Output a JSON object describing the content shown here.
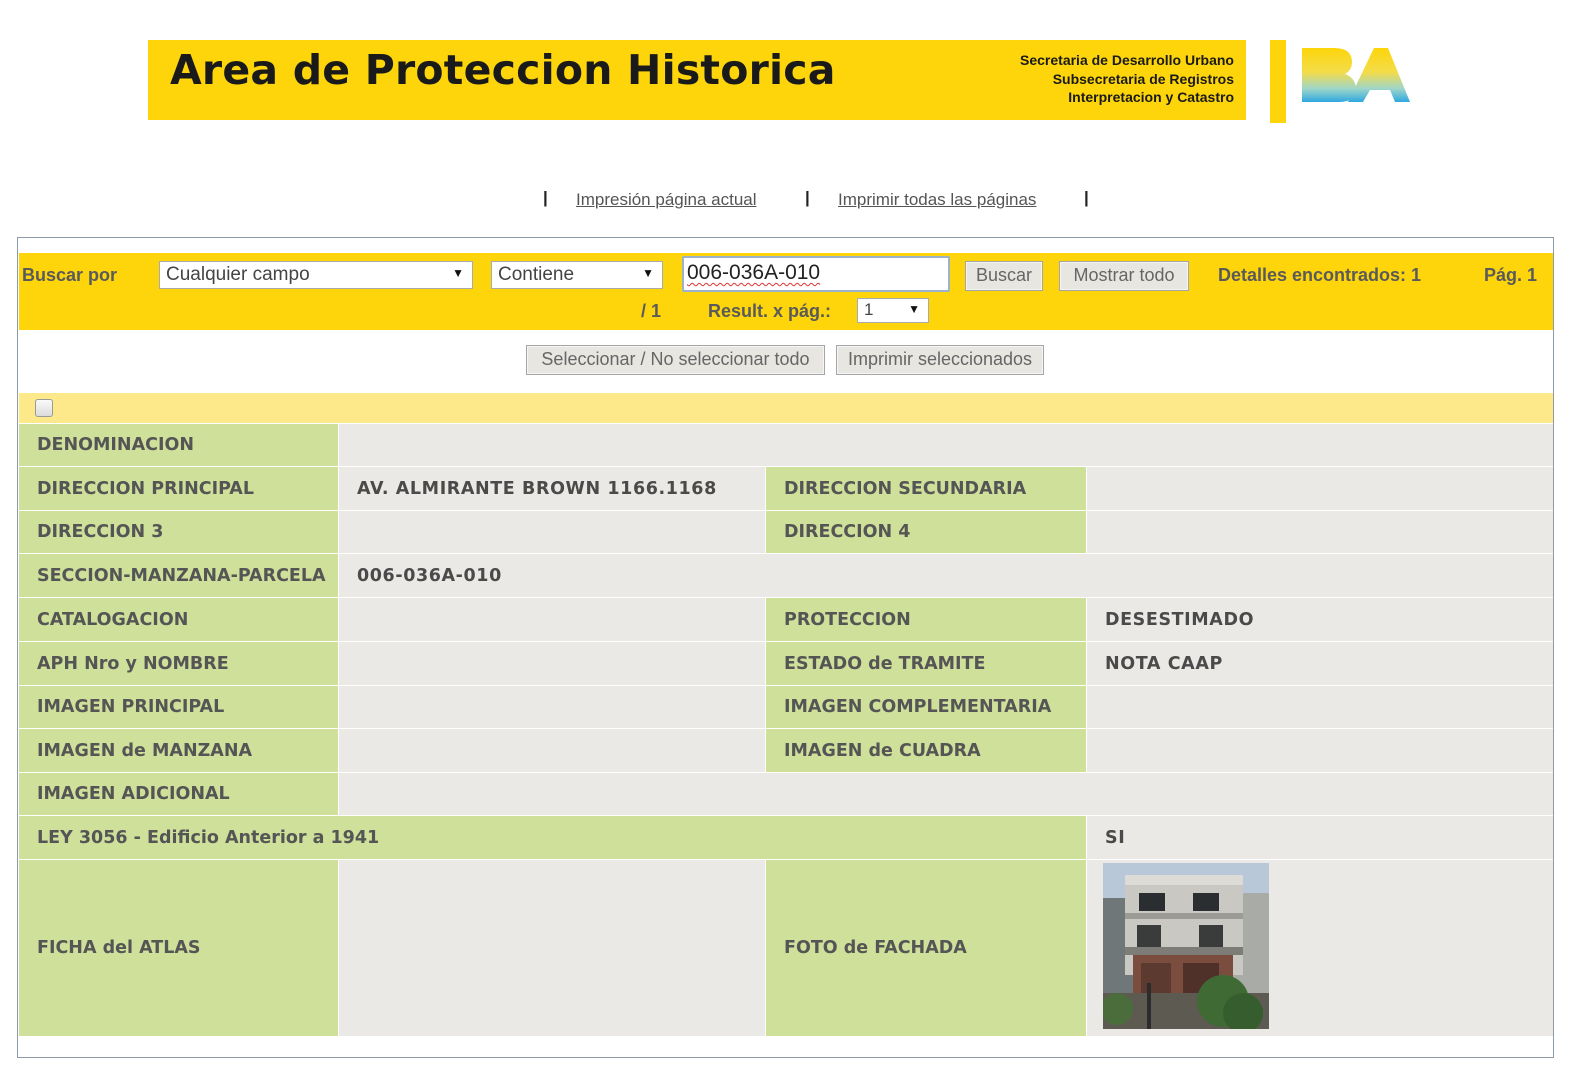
{
  "header": {
    "title": "Area de Proteccion Historica",
    "subtitle_lines": [
      "Secretaria de Desarrollo Urbano",
      "Subsecretaria de Registros",
      "Interpretacion y Catastro"
    ],
    "logo": "BA",
    "brand_color": "#fdd50a"
  },
  "print_links": {
    "separator": "|",
    "current_page": "Impresión página actual",
    "all_pages": "Imprimir todas las páginas"
  },
  "search": {
    "label": "Buscar por",
    "field_select": "Cualquier campo",
    "operator_select": "Contiene",
    "query": "006-036A-010",
    "search_button": "Buscar",
    "show_all_button": "Mostrar todo",
    "found_text": "Detalles encontrados: 1",
    "page_label": "Pág. 1",
    "page_total": "/ 1",
    "results_per_page_label": "Result. x pág.:",
    "results_per_page": "1"
  },
  "actions": {
    "select_all": "Seleccionar / No seleccionar todo",
    "print_selected": "Imprimir seleccionados"
  },
  "detail": {
    "denominacion_label": "DENOMINACION",
    "direccion_principal_label": "DIRECCION PRINCIPAL",
    "direccion_principal": "AV. ALMIRANTE BROWN 1166.1168",
    "direccion_secundaria_label": "DIRECCION SECUNDARIA",
    "direccion_3_label": "DIRECCION 3",
    "direccion_4_label": "DIRECCION 4",
    "smp_label": "SECCION-MANZANA-PARCELA",
    "smp": "006-036A-010",
    "catalogacion_label": "CATALOGACION",
    "proteccion_label": "PROTECCION",
    "proteccion": "DESESTIMADO",
    "aph_label": "APH Nro y NOMBRE",
    "estado_label": "ESTADO de TRAMITE",
    "estado": "NOTA CAAP",
    "imagen_principal_label": "IMAGEN PRINCIPAL",
    "imagen_complementaria_label": "IMAGEN COMPLEMENTARIA",
    "imagen_manzana_label": "IMAGEN de MANZANA",
    "imagen_cuadra_label": "IMAGEN de CUADRA",
    "imagen_adicional_label": "IMAGEN ADICIONAL",
    "ley_label": "LEY 3056 - Edificio Anterior a 1941",
    "ley": "SI",
    "ficha_label": "FICHA del ATLAS",
    "foto_label": "FOTO de FACHADA"
  },
  "colors": {
    "label_cell": "#cfe09a",
    "value_cell": "#ebe9e5",
    "checkbar": "#fde98a"
  }
}
